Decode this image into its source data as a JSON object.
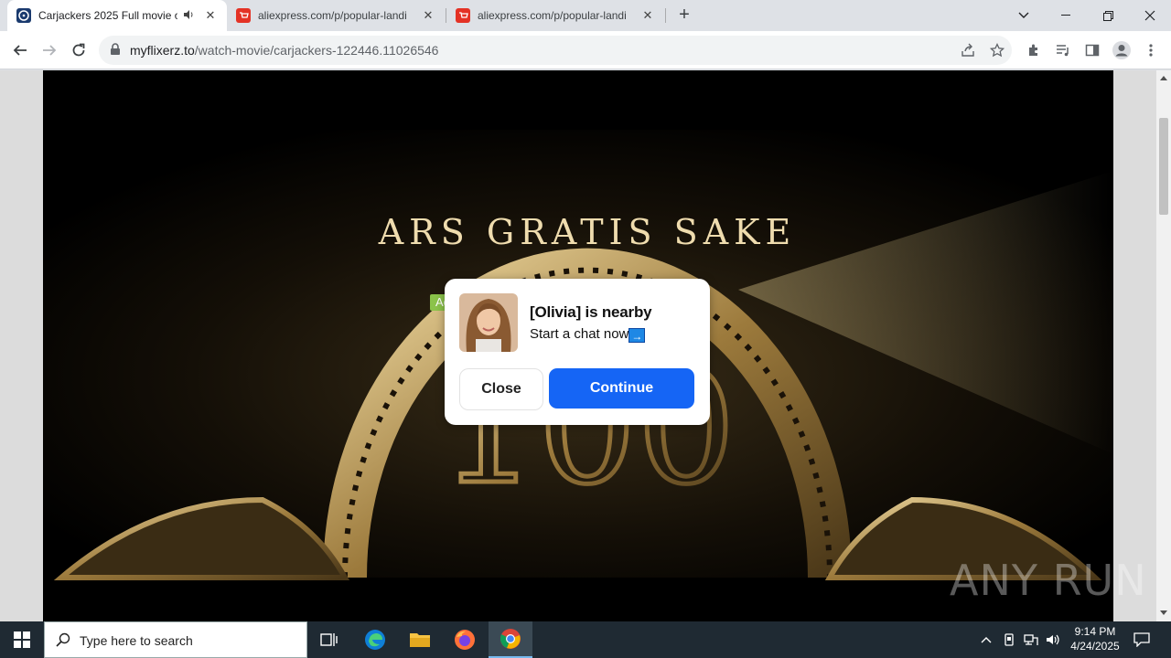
{
  "browser": {
    "tabs": [
      {
        "title": "Carjackers 2025 Full movie o",
        "audio_icon": "speaker-icon"
      },
      {
        "title": "aliexpress.com/p/popular-landi"
      },
      {
        "title": "aliexpress.com/p/popular-landi"
      }
    ],
    "url_host": "myflixerz.to",
    "url_path": "/watch-movie/carjackers-122446.11026546"
  },
  "video": {
    "logo_text_arc": "ARS GRATIS SAKE",
    "logo_number": "100"
  },
  "ad": {
    "badge": "Ad",
    "title": "[Olivia] is nearby",
    "subtitle": "Start a chat now",
    "arrow": "→",
    "close_label": "Close",
    "continue_label": "Continue",
    "colors": {
      "continue": "#1565f5",
      "badge": "#8bc34a"
    }
  },
  "watermark": "ANY RUN",
  "taskbar": {
    "search_placeholder": "Type here to search",
    "time": "9:14 PM",
    "date": "4/24/2025"
  }
}
